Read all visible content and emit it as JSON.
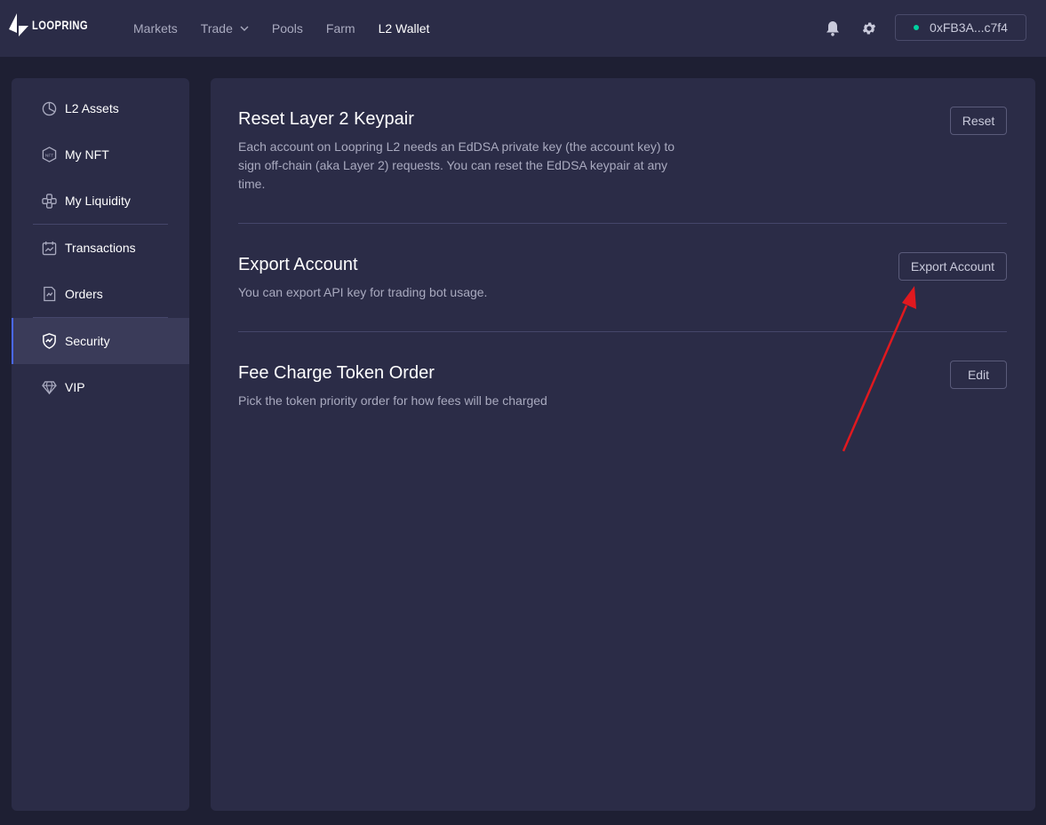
{
  "header": {
    "logo_text": "LOOPRING",
    "nav": [
      {
        "label": "Markets"
      },
      {
        "label": "Trade"
      },
      {
        "label": "Pools"
      },
      {
        "label": "Farm"
      },
      {
        "label": "L2 Wallet"
      }
    ],
    "wallet_address": "0xFB3A...c7f4",
    "icons": [
      "bell-icon",
      "gear-icon"
    ]
  },
  "sidebar": {
    "items": [
      {
        "label": "L2 Assets",
        "icon": "pie-chart-icon"
      },
      {
        "label": "My NFT",
        "icon": "nft-icon"
      },
      {
        "label": "My Liquidity",
        "icon": "liquidity-icon"
      },
      {
        "label": "Transactions",
        "icon": "calendar-icon"
      },
      {
        "label": "Orders",
        "icon": "orders-icon"
      },
      {
        "label": "Security",
        "icon": "shield-icon"
      },
      {
        "label": "VIP",
        "icon": "diamond-icon"
      }
    ],
    "active": "Security"
  },
  "main": {
    "sections": [
      {
        "title": "Reset Layer 2 Keypair",
        "description": "Each account on Loopring L2 needs an EdDSA private key (the account key) to sign off-chain (aka Layer 2) requests. You can reset the EdDSA keypair at any time.",
        "button": "Reset"
      },
      {
        "title": "Export Account",
        "description": "You can export API key for trading bot usage.",
        "button": "Export Account"
      },
      {
        "title": "Fee Charge Token Order",
        "description": "Pick the token priority order for how fees will be charged",
        "button": "Edit"
      }
    ]
  },
  "colors": {
    "background": "#1e1f33",
    "panel": "#2b2c47",
    "accent": "#4a68ff",
    "status_dot": "#00d1a0",
    "annotation_arrow": "#e0191f"
  }
}
